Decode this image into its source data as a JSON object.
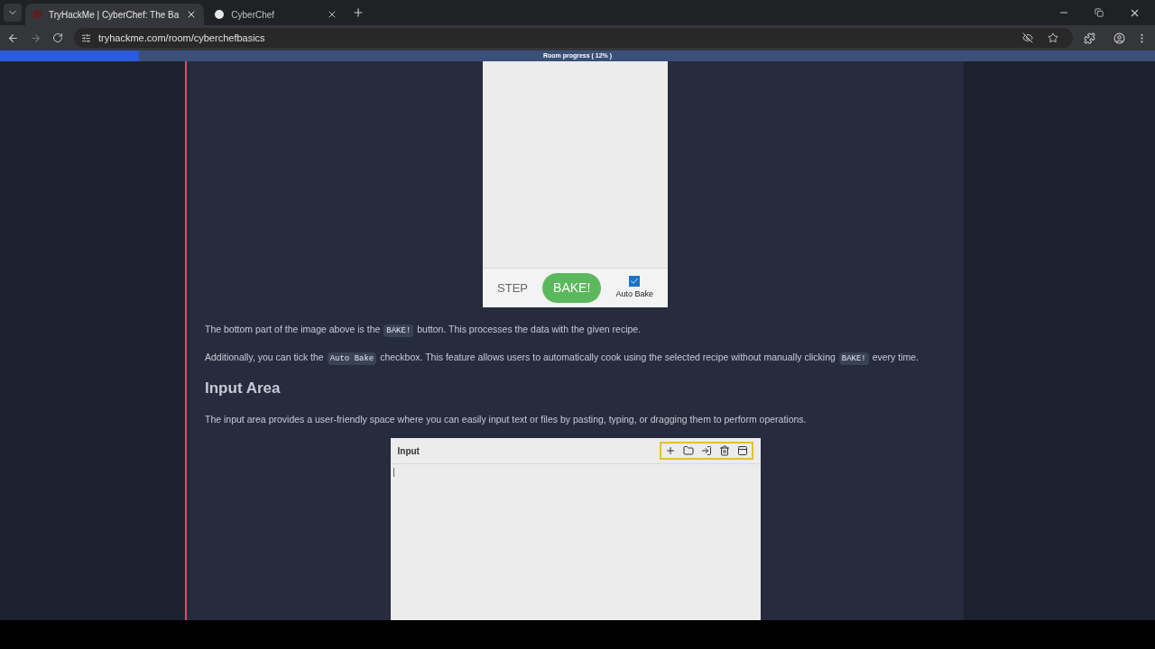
{
  "browser": {
    "tabs": [
      {
        "title": "TryHackMe | CyberChef: The Ba",
        "selected": true
      },
      {
        "title": "CyberChef",
        "selected": false
      }
    ],
    "url": "tryhackme.com/room/cyberchefbasics"
  },
  "progress": {
    "label": "Room progress ( 12% )",
    "level": 0.12
  },
  "recipe_panel": {
    "step": "STEP",
    "bake": "BAKE!",
    "auto_bake": {
      "label": "Auto Bake",
      "checked": true
    }
  },
  "paragraphs": [
    [
      {
        "kind": "text",
        "text": "The bottom part of the image above is the "
      },
      {
        "kind": "code",
        "text": "BAKE!"
      },
      {
        "kind": "text",
        "text": " button. This processes the data with the given recipe."
      }
    ],
    [
      {
        "kind": "text",
        "text": "Additionally, you can tick the "
      },
      {
        "kind": "code",
        "text": "Auto Bake"
      },
      {
        "kind": "text",
        "text": " checkbox. This feature allows users to automatically cook using the selected recipe without manually clicking "
      },
      {
        "kind": "code",
        "text": "BAKE!"
      },
      {
        "kind": "text",
        "text": " every time."
      }
    ]
  ],
  "heading": "Input Area",
  "intro": "The input area provides a user-friendly space where you can easily input text or files by pasting, typing, or dragging them to perform operations.",
  "input_panel": {
    "title": "Input"
  }
}
